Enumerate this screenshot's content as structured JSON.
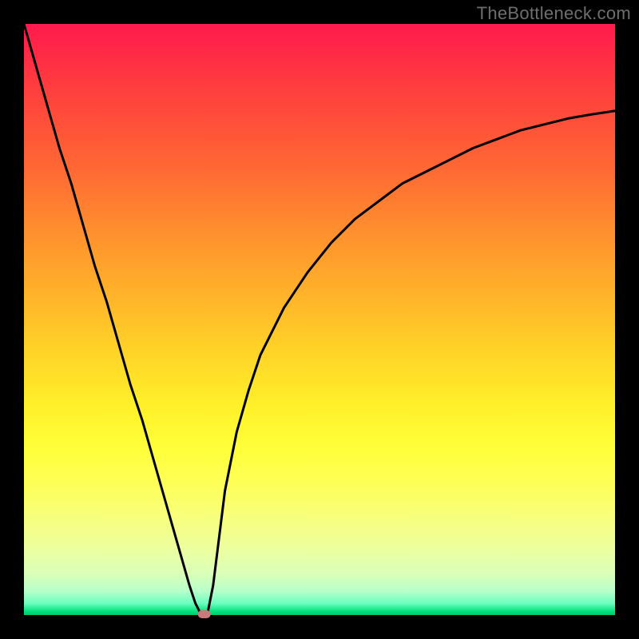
{
  "watermark": "TheBottleneck.com",
  "gradient_colors": {
    "top": "#ff1a4d",
    "mid_upper": "#ff8f2e",
    "mid": "#ffd227",
    "mid_lower": "#fdff58",
    "bottom_green": "#00c96f"
  },
  "chart_data": {
    "type": "line",
    "title": "",
    "xlabel": "",
    "ylabel": "",
    "xlim": [
      0,
      100
    ],
    "ylim": [
      0,
      100
    ],
    "grid": false,
    "legend": false,
    "annotations": [],
    "series": [
      {
        "name": "bottleneck-curve",
        "color": "#000000",
        "x": [
          0,
          2,
          4,
          6,
          8,
          10,
          12,
          14,
          16,
          18,
          20,
          22,
          24,
          26,
          28,
          29,
          30,
          31,
          32,
          33,
          34,
          36,
          38,
          40,
          44,
          48,
          52,
          56,
          60,
          64,
          68,
          72,
          76,
          80,
          84,
          88,
          92,
          96,
          100
        ],
        "y": [
          100,
          93,
          86,
          79,
          73,
          66,
          59,
          53,
          46,
          39,
          33,
          26,
          19,
          12,
          5,
          2,
          0,
          0,
          5,
          13,
          21,
          31,
          38,
          44,
          52,
          58,
          63,
          67,
          70,
          73,
          75,
          77,
          79,
          80.5,
          82,
          83,
          84,
          84.7,
          85.3
        ]
      }
    ],
    "marker": {
      "name": "optimum-point",
      "x": 30.5,
      "y": 0,
      "color": "#c97a7a",
      "shape": "rounded-pill"
    }
  }
}
